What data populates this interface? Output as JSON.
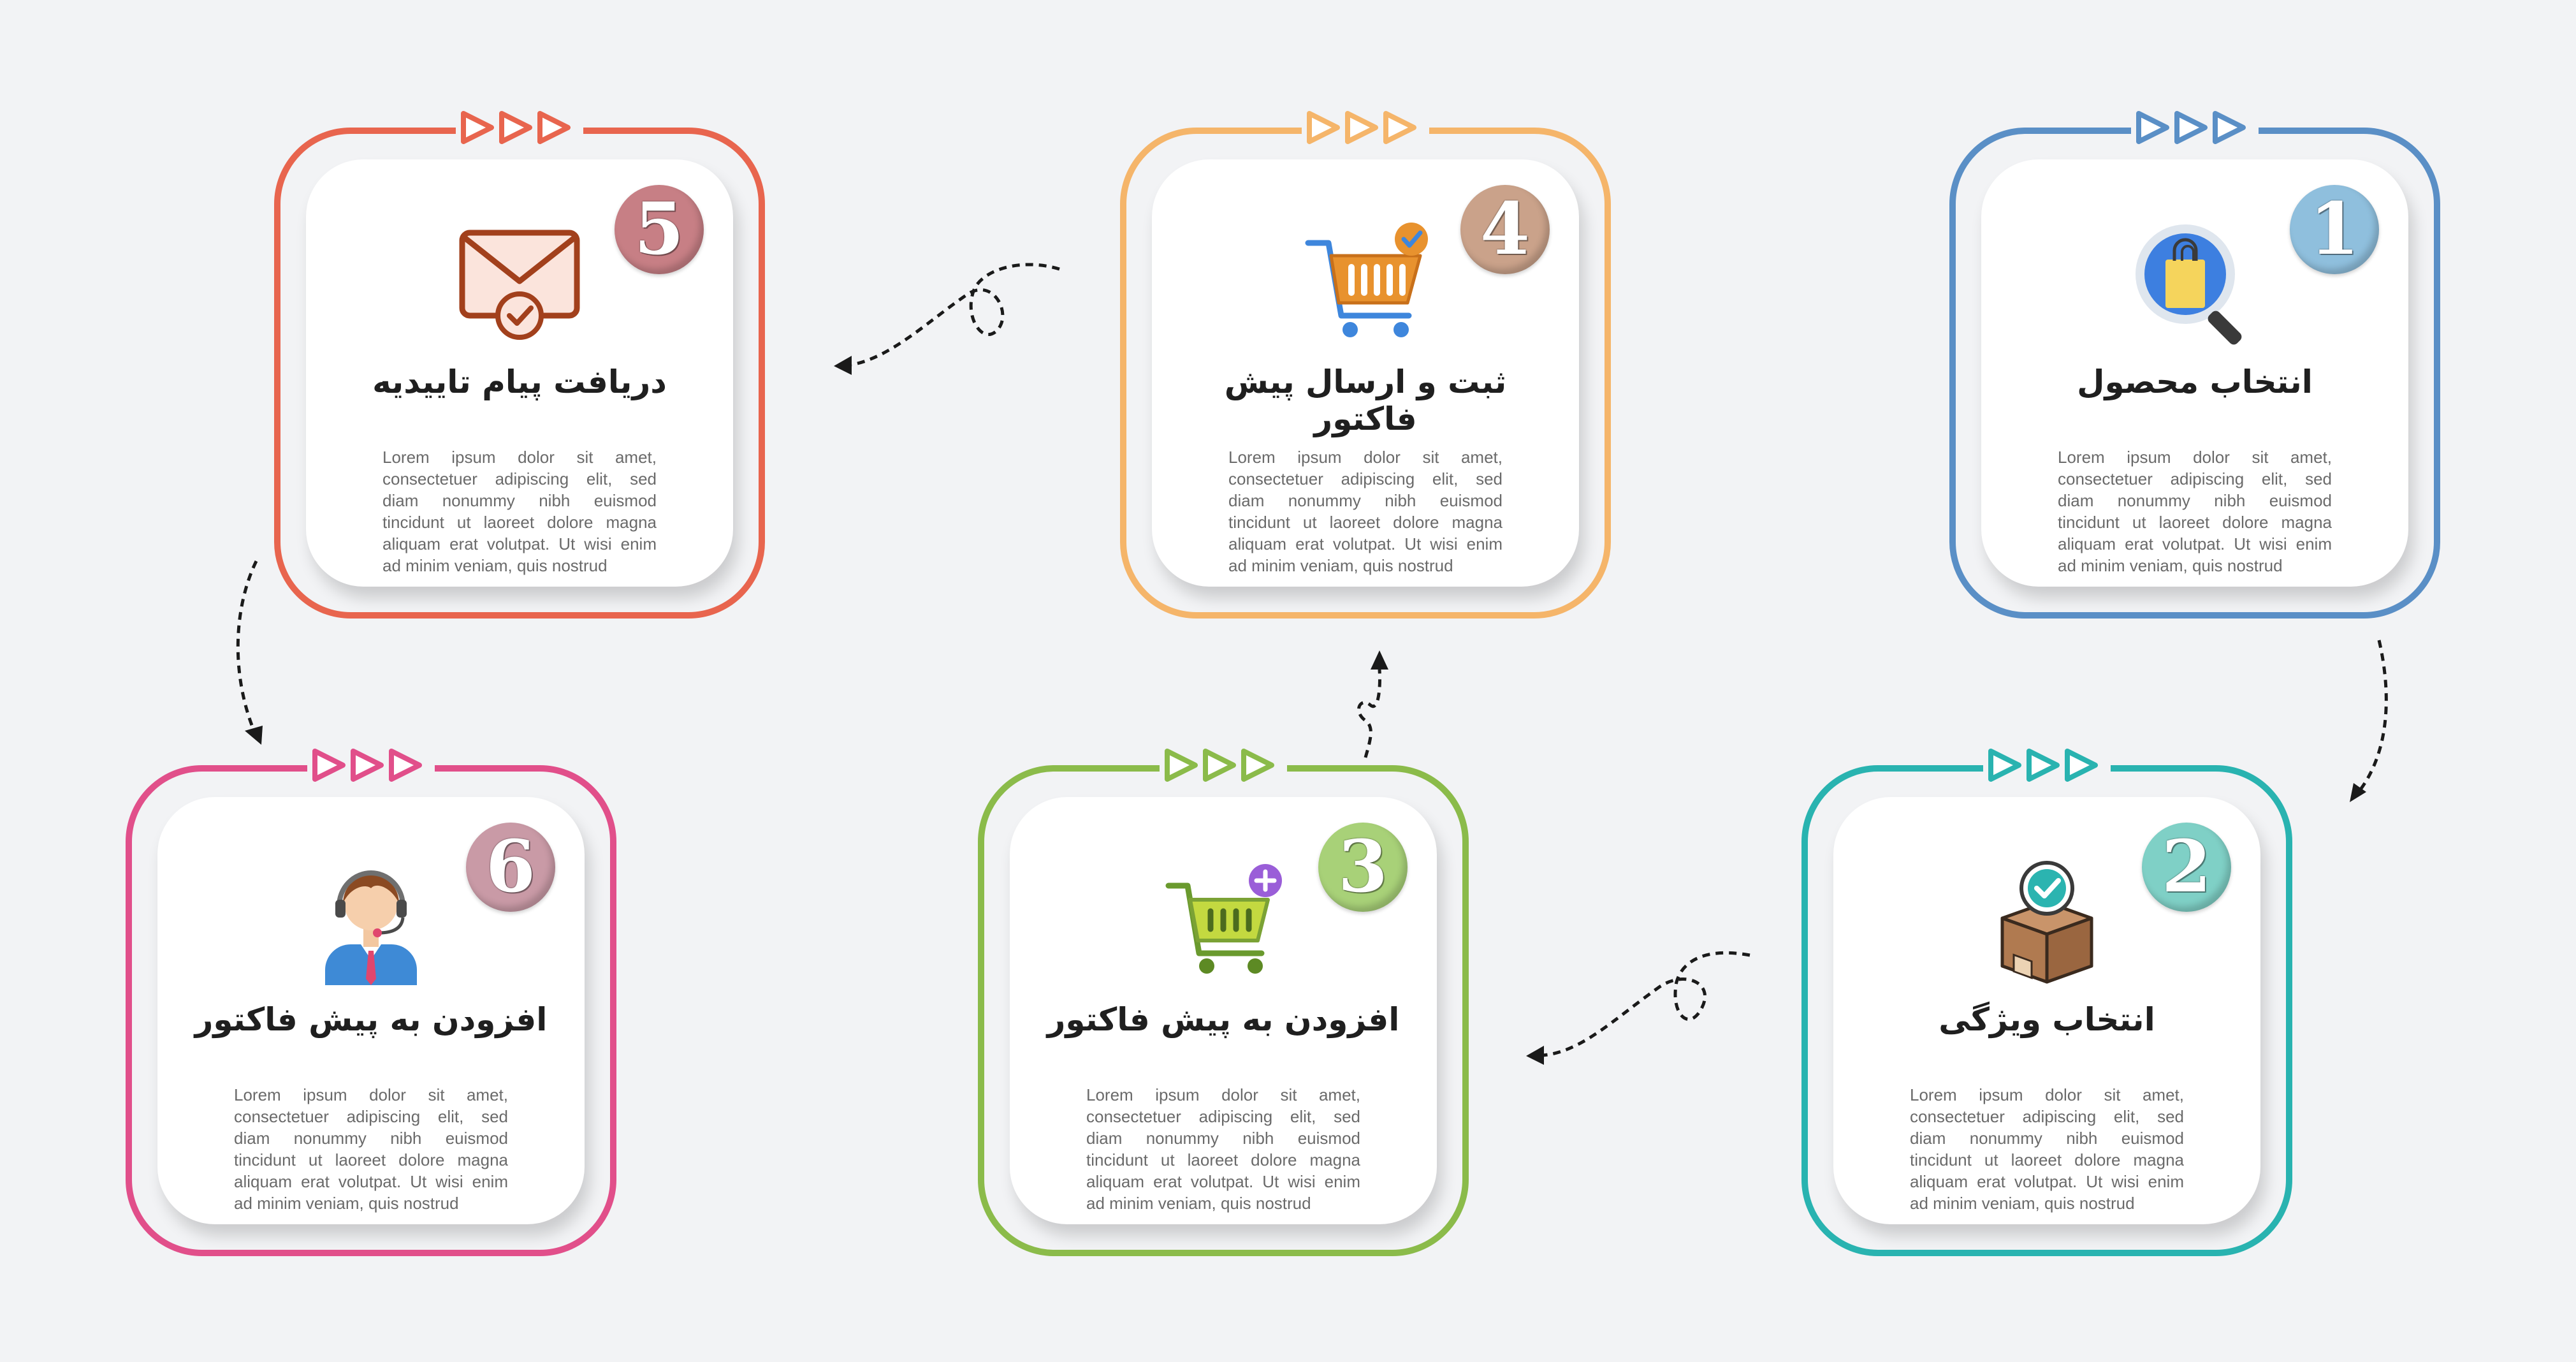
{
  "steps": [
    {
      "number": "1",
      "title": "انتخاب محصول",
      "description": "Lorem ipsum dolor sit amet, consectetuer adipiscing elit, sed diam nonummy nibh euismod tincidunt ut laoreet dolore magna aliquam erat volutpat. Ut wisi enim ad minim veniam, quis nostrud",
      "icon": "magnifier-shopping-bag-icon",
      "accent": "#5a8fc6",
      "badge_color": "#8fbfdd"
    },
    {
      "number": "2",
      "title": "انتخاب ویژگی",
      "description": "Lorem ipsum dolor sit amet, consectetuer adipiscing elit, sed diam nonummy nibh euismod tincidunt ut laoreet dolore magna aliquam erat volutpat. Ut wisi enim ad minim veniam, quis nostrud",
      "icon": "checked-box-icon",
      "accent": "#29b3b0",
      "badge_color": "#7fd0c6"
    },
    {
      "number": "3",
      "title": "افزودن به پیش فاکتور",
      "description": "Lorem ipsum dolor sit amet, consectetuer adipiscing elit, sed diam nonummy nibh euismod tincidunt ut laoreet dolore magna aliquam erat volutpat. Ut wisi enim ad minim veniam, quis nostrud",
      "icon": "add-to-cart-icon",
      "accent": "#8bbb4a",
      "badge_color": "#a8d178"
    },
    {
      "number": "4",
      "title": "ثبت و ارسال پیش فاکتور",
      "description": "Lorem ipsum dolor sit amet, consectetuer adipiscing elit, sed diam nonummy nibh euismod tincidunt ut laoreet dolore magna aliquam erat volutpat. Ut wisi enim ad minim veniam, quis nostrud",
      "icon": "cart-checkout-icon",
      "accent": "#f5b56a",
      "badge_color": "#caa28a"
    },
    {
      "number": "5",
      "title": "دریافت پیام تاییدیه",
      "description": "Lorem ipsum dolor sit amet, consectetuer adipiscing elit, sed diam nonummy nibh euismod tincidunt ut laoreet dolore magna aliquam erat volutpat. Ut wisi enim ad minim veniam, quis nostrud",
      "icon": "confirmation-mail-icon",
      "accent": "#e8654e",
      "badge_color": "#c77f85"
    },
    {
      "number": "6",
      "title": "افزودن به پیش فاکتور",
      "description": "Lorem ipsum dolor sit amet, consectetuer adipiscing elit, sed diam nonummy nibh euismod tincidunt ut laoreet dolore magna aliquam erat volutpat. Ut wisi enim ad minim veniam, quis nostrud",
      "icon": "support-agent-icon",
      "accent": "#e14f8a",
      "badge_color": "#c99aa6"
    }
  ]
}
